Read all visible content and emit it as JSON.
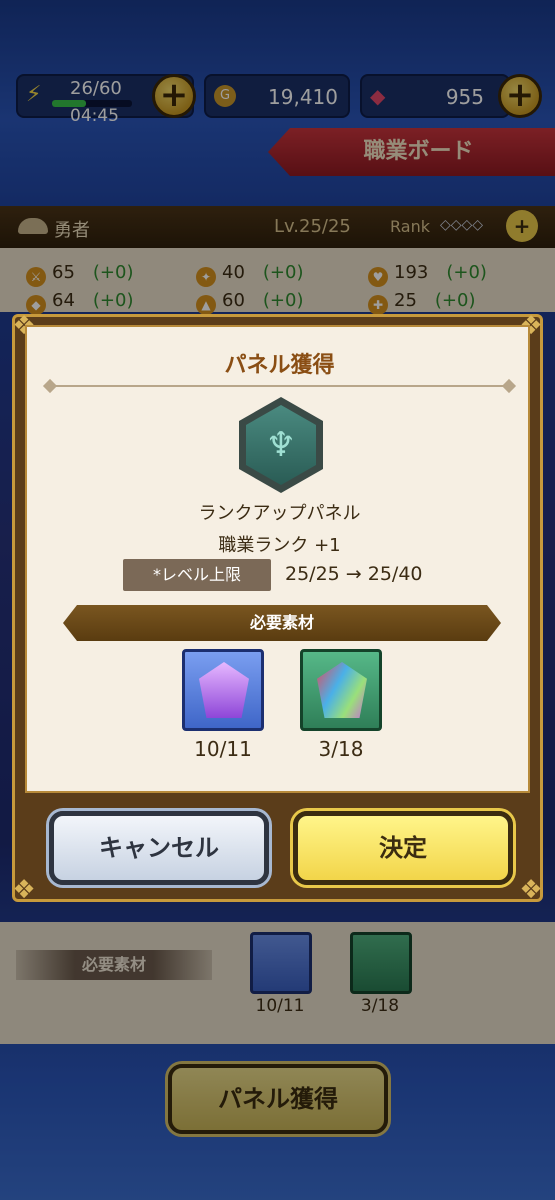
{
  "header": {
    "stamina": "26/60",
    "stamina_fraction": 0.43,
    "timer": "04:45",
    "gold": "19,410",
    "gems": "955",
    "job_board_label": "職業ボード"
  },
  "hero": {
    "name": "勇者",
    "level": "Lv.25/25",
    "rank_label": "Rank",
    "rank_marks": "◇◇◇◇"
  },
  "stats": [
    {
      "value": "65",
      "delta": "(+0)"
    },
    {
      "value": "40",
      "delta": "(+0)"
    },
    {
      "value": "193",
      "delta": "(+0)"
    },
    {
      "value": "64",
      "delta": "(+0)"
    },
    {
      "value": "60",
      "delta": "(+0)"
    },
    {
      "value": "25",
      "delta": "(+0)"
    }
  ],
  "modal": {
    "title": "パネル獲得",
    "panel_name": "ランクアップパネル",
    "effect": "職業ランク  +1",
    "level_cap_label": "*レベル上限",
    "level_cap_value": "25/25 → 25/40",
    "materials_label": "必要素材",
    "materials": [
      {
        "count": "10/11"
      },
      {
        "count": "3/18"
      }
    ],
    "cancel_label": "キャンセル",
    "confirm_label": "決定"
  },
  "background": {
    "materials_label": "必要素材",
    "materials": [
      {
        "count": "10/11"
      },
      {
        "count": "3/18"
      }
    ],
    "acquire_button": "パネル獲得"
  },
  "colors": {
    "accent_gold": "#c79a3c",
    "confirm_yellow": "#f2d54a",
    "banner_red": "#c8343c"
  }
}
